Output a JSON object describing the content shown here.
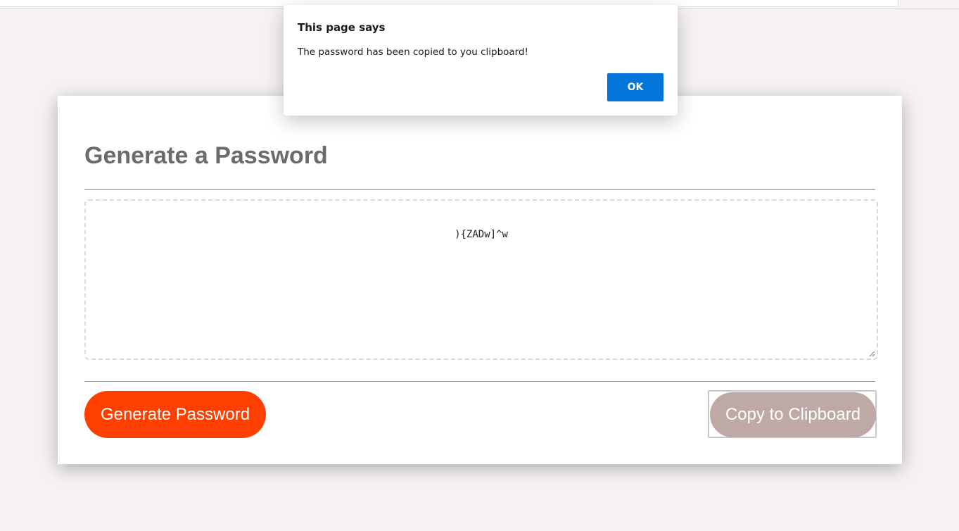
{
  "card": {
    "title": "Generate a Password",
    "password_value": "){ZADw]^w",
    "generate_label": "Generate Password",
    "copy_label": "Copy to Clipboard"
  },
  "dialog": {
    "title": "This page says",
    "message": "The password has been copied to you clipboard!",
    "ok_label": "OK"
  },
  "colors": {
    "generate_button": "#ff3f00",
    "copy_button": "#bfa9a7",
    "ok_button": "#0275d8",
    "title_text": "#6b6b6b",
    "page_background": "#f5f2f1"
  },
  "icons": {
    "textarea_resize": "resize-grip-icon"
  }
}
